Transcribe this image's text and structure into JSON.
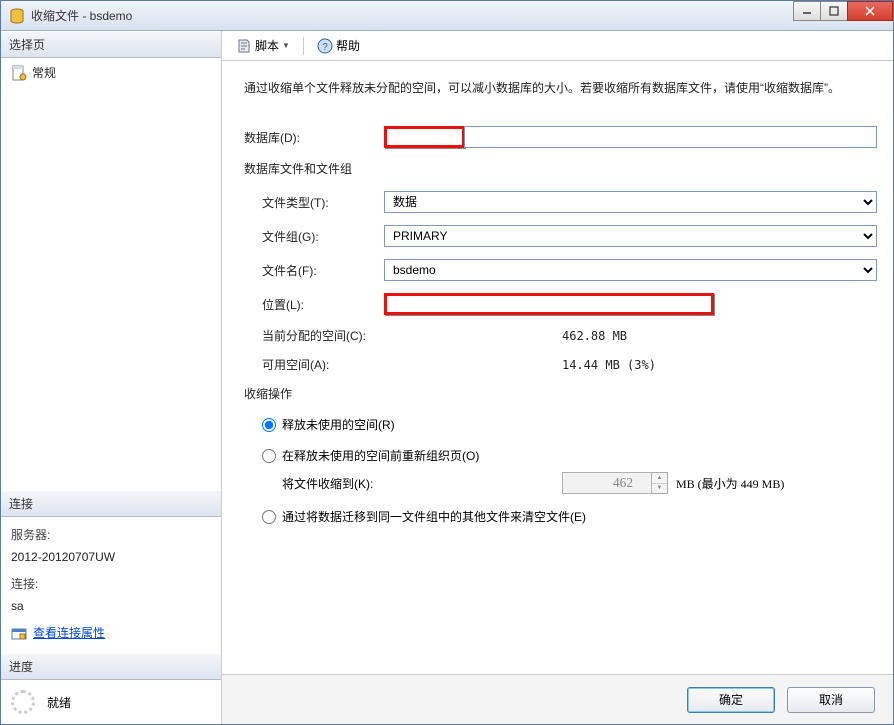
{
  "window": {
    "title": "收缩文件 - bsdemo"
  },
  "winbtns": {
    "min": "–",
    "max": "❐",
    "close": "✕"
  },
  "sidebar": {
    "select_page": "选择页",
    "general": "常规",
    "connection": "连接",
    "server_label": "服务器:",
    "server_value": "2012-20120707UW",
    "conn_label": "连接:",
    "conn_value": "sa",
    "view_conn_props": "查看连接属性",
    "progress": "进度",
    "ready": "就绪"
  },
  "toolbar": {
    "script": "脚本",
    "help": "帮助"
  },
  "main": {
    "desc": "通过收缩单个文件释放未分配的空间，可以减小数据库的大小。若要收缩所有数据库文件，请使用“收缩数据库”。",
    "db_label": "数据库(D):",
    "db_value": "",
    "filegroup_section": "数据库文件和文件组",
    "filetype_label": "文件类型(T):",
    "filetype_value": "数据",
    "filegroup_label": "文件组(G):",
    "filegroup_value": "PRIMARY",
    "filename_label": "文件名(F):",
    "filename_value": "bsdemo",
    "location_label": "位置(L):",
    "location_value": "",
    "current_alloc_label": "当前分配的空间(C):",
    "current_alloc_value": "462.88 MB",
    "avail_label": "可用空间(A):",
    "avail_value": "14.44 MB (3%)",
    "shrink_action": "收缩操作",
    "radio1": "释放未使用的空间(R)",
    "radio2": "在释放未使用的空间前重新组织页(O)",
    "shrink_to_label": "将文件收缩到(K):",
    "shrink_to_value": "462",
    "shrink_to_suffix": "MB (最小为 449 MB)",
    "radio3": "通过将数据迁移到同一文件组中的其他文件来清空文件(E)"
  },
  "footer": {
    "ok": "确定",
    "cancel": "取消"
  }
}
